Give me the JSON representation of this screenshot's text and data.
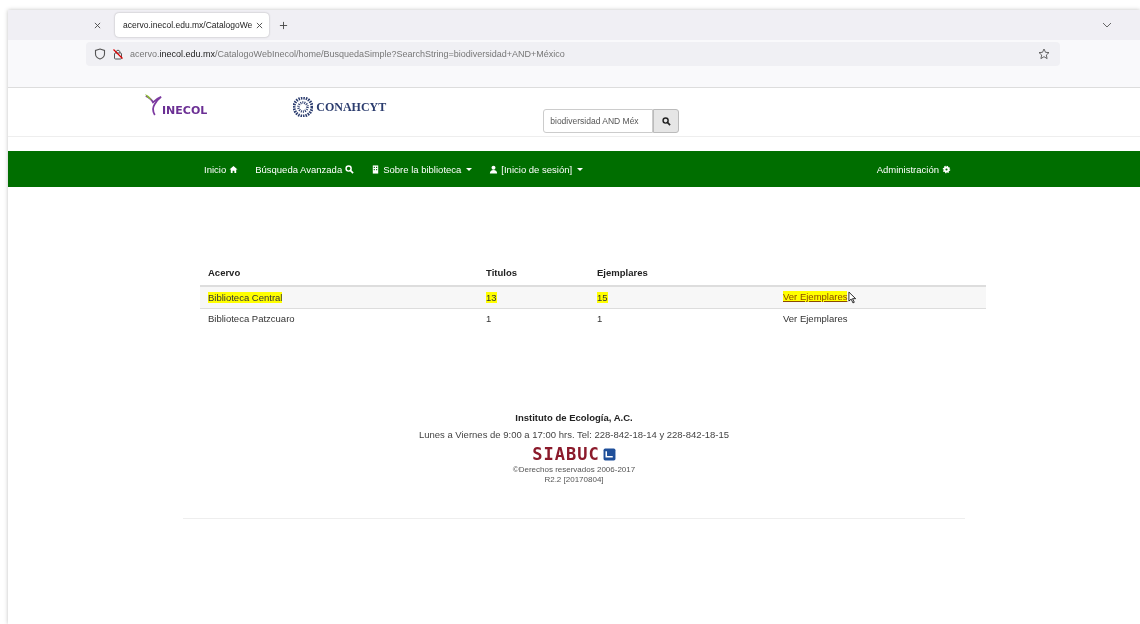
{
  "browser": {
    "tabs": [
      {
        "label": "acervo.inecol.edu.mx/CatalogoWe",
        "selected": true
      }
    ],
    "url": {
      "host_pre": "acervo.",
      "host": "inecol.edu.mx",
      "path": "/CatalogoWebInecol/home/BusquedaSimple?SearchString=biodiversidad+AND+México"
    }
  },
  "header": {
    "logo_left": "INECOL",
    "logo_right": "CONAHCYT",
    "search": {
      "value": "biodiversidad AND Méx"
    }
  },
  "nav": {
    "items": [
      {
        "label": "Inicio",
        "kind": "home",
        "dropdown": false
      },
      {
        "label": "Búsqueda Avanzada",
        "kind": "search",
        "dropdown": false
      },
      {
        "label": "Sobre la biblioteca",
        "kind": "building",
        "dropdown": true
      },
      {
        "label": "[Inicio de sesión]",
        "kind": "user",
        "dropdown": true
      }
    ],
    "right": {
      "label": "Administración",
      "kind": "gear",
      "dropdown": false
    }
  },
  "table": {
    "columns": [
      "Acervo",
      "Titulos",
      "Ejemplares"
    ],
    "rows": [
      {
        "cells": [
          "Biblioteca Central",
          "13",
          "15"
        ],
        "link": "Ver Ejemplares",
        "highlighted": true
      },
      {
        "cells": [
          "Biblioteca Patzcuaro",
          "1",
          "1"
        ],
        "link": "Ver Ejemplares",
        "highlighted": false
      }
    ]
  },
  "footer": {
    "institute": "Instituto de Ecología, A.C.",
    "hours": "Lunes a Viernes de 9:00 a 17:00 hrs. Tel: 228-842-18-14 y 228-842-18-15",
    "logo": "SIABUC",
    "copyright": "©Derechos reservados 2006-2017",
    "version": "R2.2 [20170804]"
  }
}
